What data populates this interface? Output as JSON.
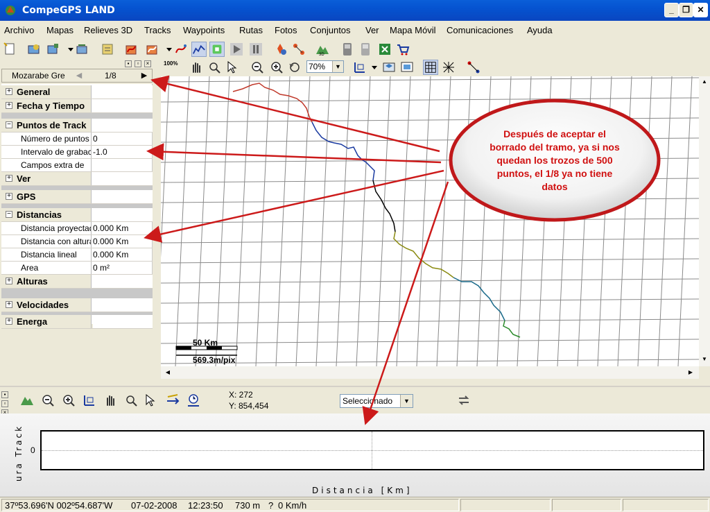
{
  "window": {
    "title": "CompeGPS LAND"
  },
  "menu": [
    "Archivo",
    "Mapas",
    "Relieves 3D",
    "Tracks",
    "Waypoints",
    "Rutas",
    "Fotos",
    "Conjuntos",
    "Ver",
    "Mapa Móvil",
    "Comunicaciones",
    "Ayuda"
  ],
  "toolbar2": {
    "zoom_100_label": "100%",
    "zoom_value": "70%"
  },
  "track_nav": {
    "name": "Mozarabe Gre",
    "page": "1/8"
  },
  "properties": [
    {
      "type": "category",
      "name": "General",
      "expanded": false,
      "value": ""
    },
    {
      "type": "category",
      "name": "Fecha y Tiempo",
      "expanded": false,
      "value": ""
    },
    {
      "type": "category",
      "name": "Puntos de Track",
      "expanded": true,
      "value": ""
    },
    {
      "type": "field",
      "name": "Número de puntos",
      "value": "0"
    },
    {
      "type": "field",
      "name": "Intervalo de grabación",
      "value": "-1.0"
    },
    {
      "type": "field",
      "name": "Campos extra de",
      "value": ""
    },
    {
      "type": "category",
      "name": "Ver",
      "expanded": false,
      "value": ""
    },
    {
      "type": "category",
      "name": "GPS",
      "expanded": false,
      "value": ""
    },
    {
      "type": "category",
      "name": "Distancias",
      "expanded": true,
      "value": ""
    },
    {
      "type": "field",
      "name": "Distancia proyectada",
      "value": "0.000 Km"
    },
    {
      "type": "field",
      "name": "Distancia con altura",
      "value": "0.000 Km"
    },
    {
      "type": "field",
      "name": "Distancia lineal",
      "value": "0.000 Km"
    },
    {
      "type": "field",
      "name": "Area",
      "value": "0 m²"
    },
    {
      "type": "category",
      "name": "Alturas",
      "expanded": false,
      "value": ""
    },
    {
      "type": "category",
      "name": "Velocidades",
      "expanded": false,
      "value": ""
    },
    {
      "type": "category",
      "name": "Energa",
      "expanded": false,
      "value": ""
    }
  ],
  "map": {
    "scale_label": "50 Km",
    "resolution": "569.3m/pix",
    "annotation": "Después de aceptar el borrado del tramo, ya si nos quedan los trozos de 500 puntos, el 1/8 ya no tiene datos"
  },
  "profile": {
    "cursor_x": "X: 272",
    "cursor_y": "Y: 854,454",
    "selection_mode": "Seleccionado",
    "y_axis_label": "ura Track",
    "y_tick": "0",
    "x_axis_label": "Distancia [Km]"
  },
  "status": {
    "position": "37º53.696'N 002º54.687'W",
    "date": "07-02-2008",
    "time": "12:23:50",
    "altitude": "730 m",
    "unknown": "?",
    "speed": "0 Km/h"
  },
  "colors": {
    "annotation_text": "#d01010",
    "arrow": "#cc1a1a",
    "titlebar": "#0a5fd8",
    "track_red": "#c0392b",
    "track_blue": "#1a3aa0",
    "track_black": "#000000",
    "track_olive": "#8a8a10",
    "track_teal": "#1a6a8a",
    "track_green": "#2a8a2a"
  }
}
